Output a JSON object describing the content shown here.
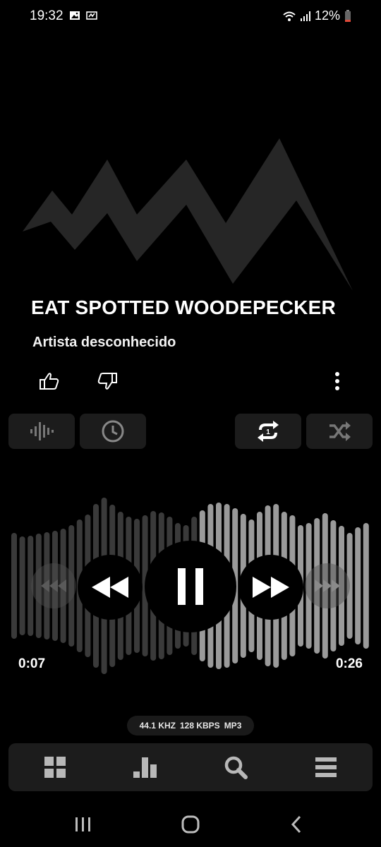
{
  "status_bar": {
    "time": "19:32",
    "battery": "12%",
    "icons": [
      "image-icon",
      "data-saver-icon",
      "wifi-icon",
      "signal-icon",
      "battery-low-icon"
    ]
  },
  "track": {
    "title": "EAT SPOTTED WOODEPECKER",
    "artist": "Artista desconhecido"
  },
  "rating": {
    "like_icon": "thumbs-up-icon",
    "dislike_icon": "thumbs-down-icon"
  },
  "toolbar": {
    "left": [
      "waveform-icon",
      "clock-icon"
    ],
    "right": [
      "repeat-one-icon",
      "shuffle-icon"
    ]
  },
  "playback": {
    "elapsed": "0:07",
    "remaining": "0:26",
    "state": "playing",
    "progress_fraction": 0.52
  },
  "format": {
    "sample_rate": "44.1 KHZ",
    "bitrate": "128 KBPS",
    "codec": "MP3"
  },
  "bottom_nav": [
    "grid-icon",
    "equalizer-icon",
    "search-icon",
    "list-icon"
  ],
  "system_nav": [
    "recents-icon",
    "home-icon",
    "back-icon"
  ],
  "colors": {
    "background": "#000000",
    "panel": "#1c1c1c",
    "artwork": "#262626",
    "wave_played": "#9a9a9a",
    "wave_unplayed": "#3a3a3a",
    "icon": "#b8b8b8"
  }
}
